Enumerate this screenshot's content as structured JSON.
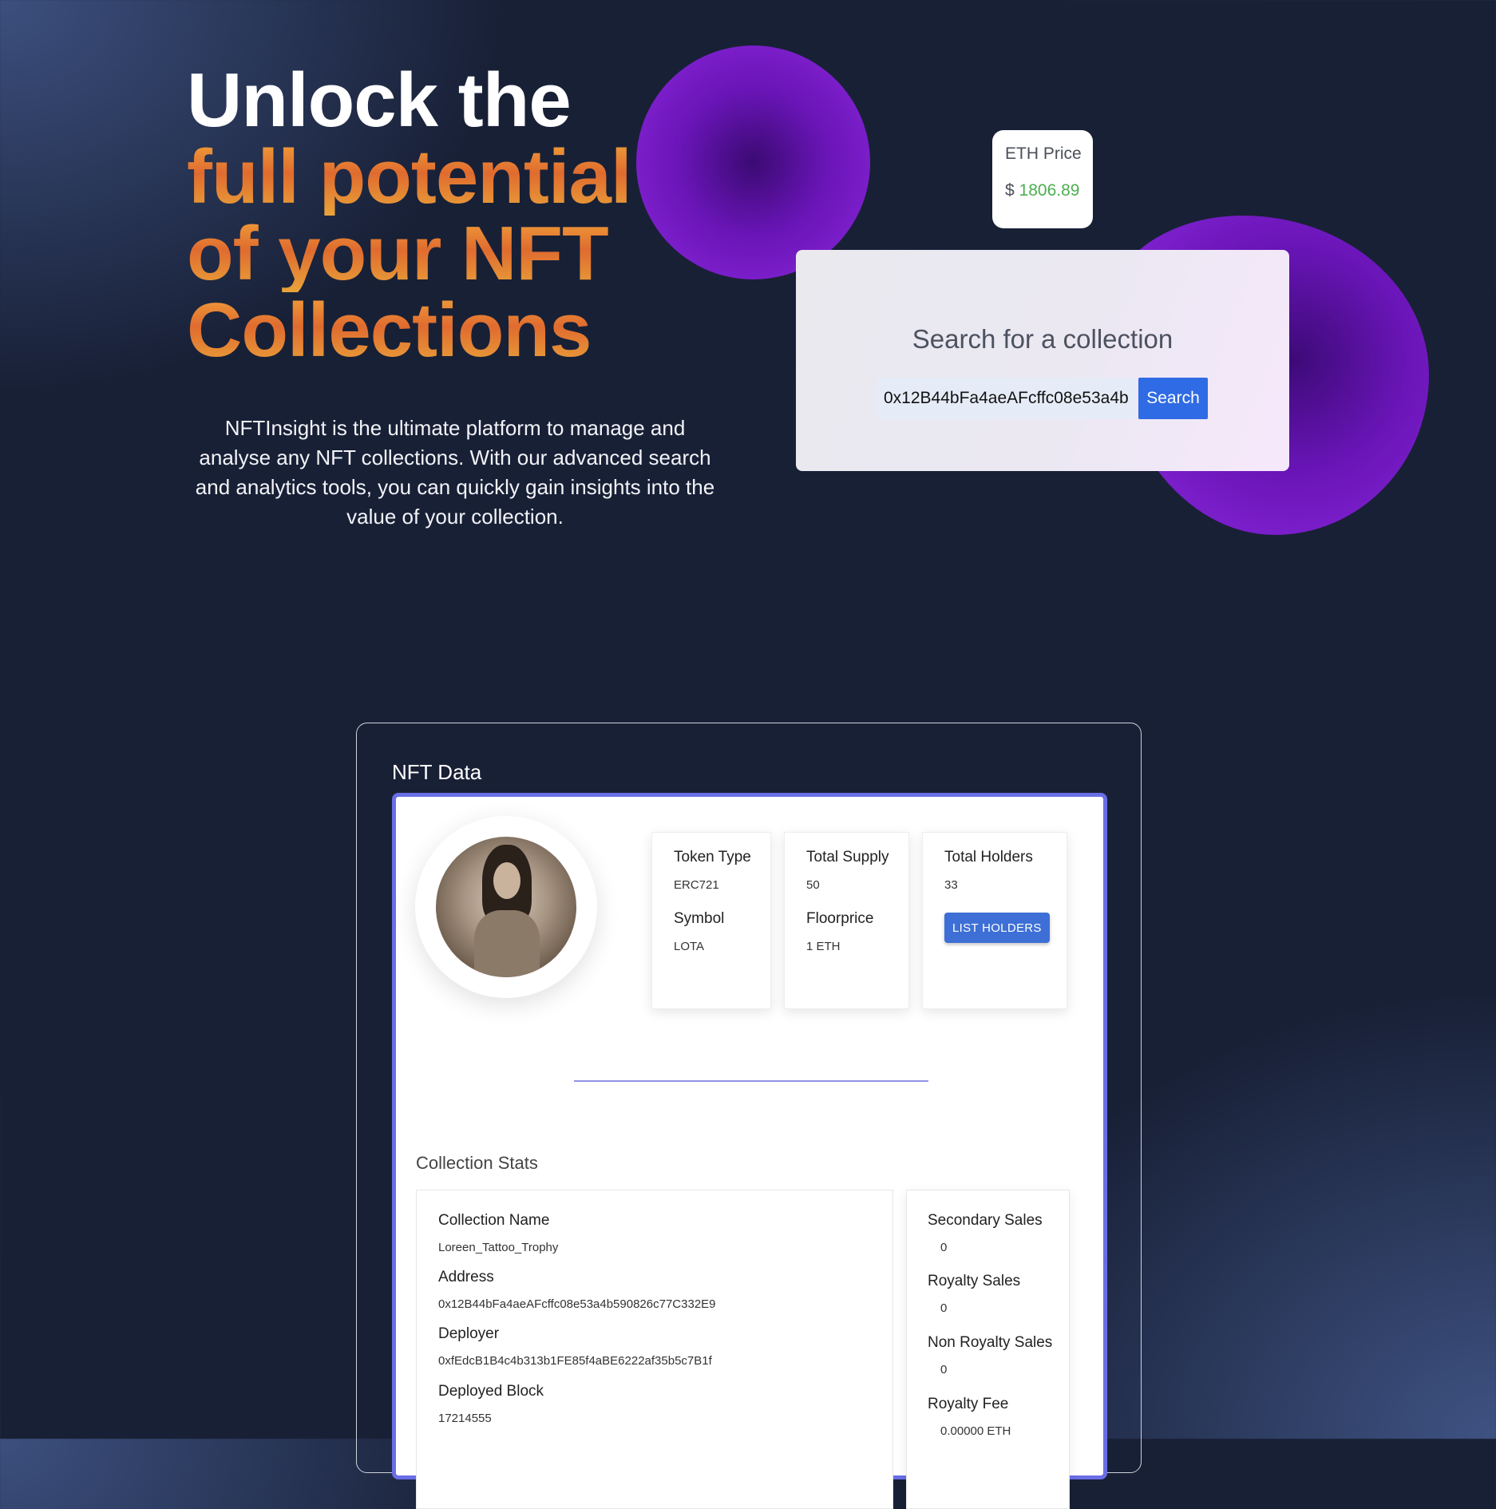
{
  "hero": {
    "title_line1": "Unlock the",
    "title_line2": "full potential",
    "title_line3": "of your NFT",
    "title_line4": "Collections",
    "description": "NFTInsight is the ultimate platform to manage and analyse any NFT collections. With our advanced search and analytics tools, you can quickly gain insights into the value of your collection."
  },
  "eth": {
    "label": "ETH Price",
    "currency": "$",
    "value": "1806.89"
  },
  "search": {
    "title": "Search for a collection",
    "input_value": "0x12B44bFa4aeAFcffc08e53a4b",
    "button_label": "Search"
  },
  "nft": {
    "heading": "NFT Data",
    "token_type_label": "Token Type",
    "token_type_value": "ERC721",
    "symbol_label": "Symbol",
    "symbol_value": "LOTA",
    "total_supply_label": "Total Supply",
    "total_supply_value": "50",
    "floorprice_label": "Floorprice",
    "floorprice_value": "1 ETH",
    "total_holders_label": "Total Holders",
    "total_holders_value": "33",
    "list_holders_label": "LIST HOLDERS"
  },
  "collection": {
    "title": "Collection Stats",
    "name_label": "Collection Name",
    "name_value": "Loreen_Tattoo_Trophy",
    "address_label": "Address",
    "address_value": "0x12B44bFa4aeAFcffc08e53a4b590826c77C332E9",
    "deployer_label": "Deployer",
    "deployer_value": "0xfEdcB1B4c4b313b1FE85f4aBE6222af35b5c7B1f",
    "block_label": "Deployed Block",
    "block_value": "17214555"
  },
  "sales": {
    "secondary_label": "Secondary Sales",
    "secondary_value": "0",
    "royalty_label": "Royalty Sales",
    "royalty_value": "0",
    "non_royalty_label": "Non Royalty Sales",
    "non_royalty_value": "0",
    "fee_label": "Royalty Fee",
    "fee_value": "0.00000 ETH"
  }
}
